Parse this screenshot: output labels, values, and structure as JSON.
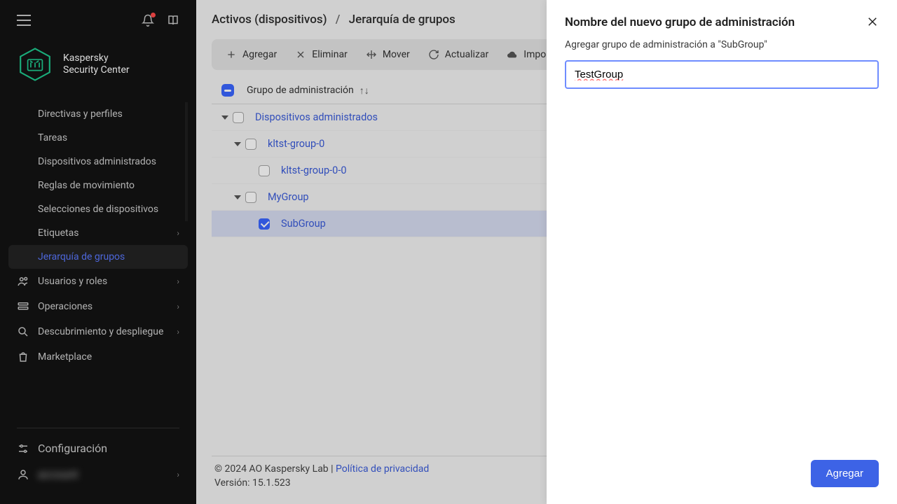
{
  "brand": {
    "line1": "Kaspersky",
    "line2": "Security Center"
  },
  "sidebar": {
    "items": [
      {
        "label": "Directivas y perfiles"
      },
      {
        "label": "Tareas"
      },
      {
        "label": "Dispositivos administrados"
      },
      {
        "label": "Reglas de movimiento"
      },
      {
        "label": "Selecciones de dispositivos"
      },
      {
        "label": "Etiquetas"
      },
      {
        "label": "Jerarquía de grupos"
      },
      {
        "label": "Usuarios y roles"
      },
      {
        "label": "Operaciones"
      },
      {
        "label": "Descubrimiento y despliegue"
      },
      {
        "label": "Marketplace"
      }
    ],
    "config_label": "Configuración",
    "user_label": "account"
  },
  "breadcrumb": {
    "root": "Activos (dispositivos)",
    "leaf": "Jerarquía de grupos",
    "sep": "/"
  },
  "toolbar": {
    "add": "Agregar",
    "remove": "Eliminar",
    "move": "Mover",
    "refresh": "Actualizar",
    "import": "Importar"
  },
  "table": {
    "column": "Grupo de administración",
    "rows": [
      {
        "label": "Dispositivos administrados",
        "indent": 0,
        "expandable": true,
        "checked": false
      },
      {
        "label": "kltst-group-0",
        "indent": 1,
        "expandable": true,
        "checked": false
      },
      {
        "label": "kltst-group-0-0",
        "indent": 2,
        "expandable": false,
        "checked": false
      },
      {
        "label": "MyGroup",
        "indent": 1,
        "expandable": true,
        "checked": false
      },
      {
        "label": "SubGroup",
        "indent": 2,
        "expandable": false,
        "checked": true,
        "selected": true
      }
    ]
  },
  "footer": {
    "copyright": "© 2024 AO Kaspersky Lab",
    "sep": " | ",
    "privacy": "Política de privacidad",
    "version": "Versión: 15.1.523"
  },
  "panel": {
    "title": "Nombre del nuevo grupo de administración",
    "subtitle": "Agregar grupo de administración a \"SubGroup\"",
    "value": "TestGroup",
    "submit": "Agregar"
  }
}
